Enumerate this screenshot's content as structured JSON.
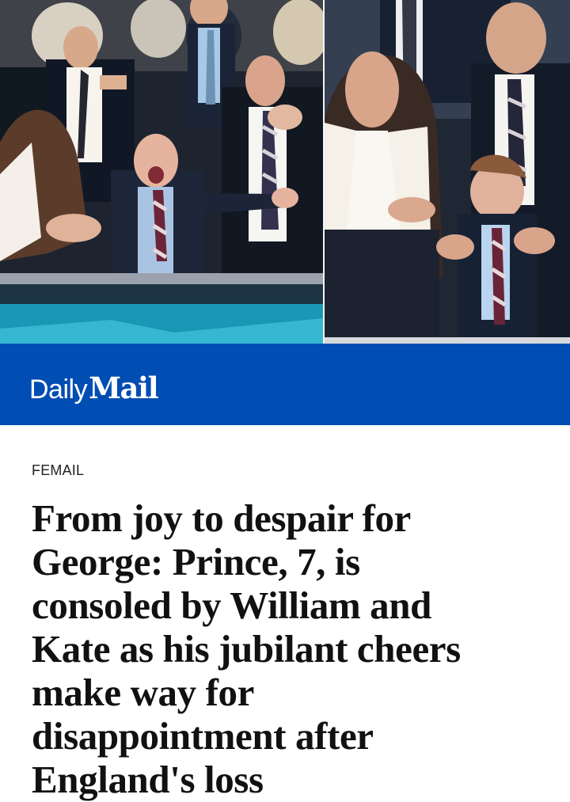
{
  "brand": {
    "daily": "Daily",
    "mail": "Mail",
    "color": "#004db3"
  },
  "article": {
    "section": "FEMAIL",
    "headline_lines": [
      "From joy to despair for",
      "George: Prince, 7, is",
      "consoled by William and",
      "Kate as his jubilant cheers",
      "make way for",
      "disappointment after",
      "England's loss"
    ]
  },
  "images": {
    "left": "stadium-celebration-photo",
    "right": "stadium-consolation-photo"
  }
}
